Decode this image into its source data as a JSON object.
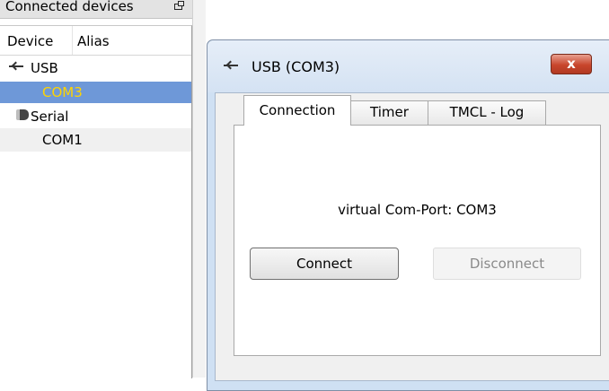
{
  "panel": {
    "title": "Connected devices",
    "columns": {
      "device": "Device",
      "alias": "Alias"
    },
    "items": [
      {
        "label": "USB",
        "icon": "usb-icon"
      },
      {
        "label": "COM3"
      },
      {
        "label": "Serial",
        "icon": "serial-port-icon"
      },
      {
        "label": "COM1"
      }
    ]
  },
  "window": {
    "title": "USB (COM3)",
    "close_label": "x",
    "tabs": [
      {
        "label": "Connection",
        "active": true
      },
      {
        "label": "Timer"
      },
      {
        "label": "TMCL - Log"
      }
    ],
    "port_text": "virtual Com-Port: COM3",
    "connect_label": "Connect",
    "disconnect_label": "Disconnect"
  },
  "colors": {
    "selection": "#6e98d8",
    "selected_text": "#ffd400",
    "close_button": "#c8452c"
  }
}
